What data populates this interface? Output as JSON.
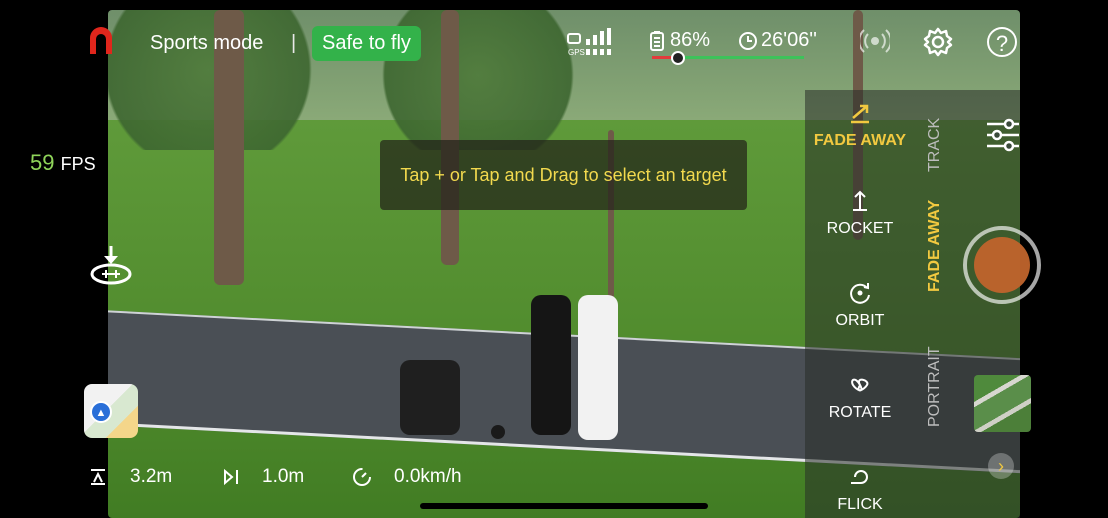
{
  "header": {
    "mode_label": "Sports mode",
    "divider": "|",
    "status_button": "Safe to fly",
    "battery_percent": "86%",
    "flight_time": "26'06''"
  },
  "fps": {
    "value": "59",
    "label": "FPS"
  },
  "hint_text": "Tap + or Tap and Drag to select an target",
  "telemetry": {
    "altitude": "3.2m",
    "distance": "1.0m",
    "speed": "0.0km/h"
  },
  "modes": [
    {
      "label": "FADE AWAY",
      "icon": "fade-away-icon",
      "active": true
    },
    {
      "label": "ROCKET",
      "icon": "rocket-icon",
      "active": false
    },
    {
      "label": "ORBIT",
      "icon": "orbit-icon",
      "active": false
    },
    {
      "label": "ROTATE",
      "icon": "rotate-icon",
      "active": false
    },
    {
      "label": "FLICK",
      "icon": "flick-icon",
      "active": false
    }
  ],
  "tabs": [
    {
      "label": "TRACK",
      "active": false
    },
    {
      "label": "FADE AWAY",
      "active": true
    },
    {
      "label": "PORTRAIT",
      "active": false
    }
  ],
  "colors": {
    "accent_yellow": "#f2c940",
    "safe_green": "#33b24a",
    "fps_green": "#8fd45a",
    "shutter_orange": "#c0642c"
  }
}
